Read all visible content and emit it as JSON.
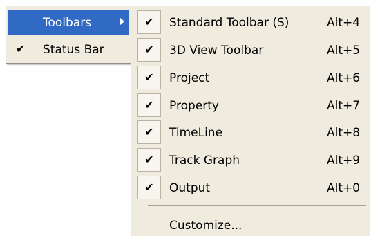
{
  "left_menu": {
    "items": [
      {
        "label": "Toolbars",
        "checked": false,
        "has_submenu": true,
        "highlighted": true
      },
      {
        "label": "Status Bar",
        "checked": true,
        "has_submenu": false,
        "highlighted": false
      }
    ]
  },
  "submenu": {
    "items": [
      {
        "label": "Standard Toolbar (S)",
        "shortcut": "Alt+4",
        "checked": true
      },
      {
        "label": "3D View Toolbar",
        "shortcut": "Alt+5",
        "checked": true
      },
      {
        "label": "Project",
        "shortcut": "Alt+6",
        "checked": true
      },
      {
        "label": "Property",
        "shortcut": "Alt+7",
        "checked": true
      },
      {
        "label": "TimeLine",
        "shortcut": "Alt+8",
        "checked": true
      },
      {
        "label": "Track Graph",
        "shortcut": "Alt+9",
        "checked": true
      },
      {
        "label": "Output",
        "shortcut": "Alt+0",
        "checked": true
      }
    ],
    "customize_label": "Customize..."
  },
  "colors": {
    "menu_bg": "#efebde",
    "highlight_bg": "#316ac5",
    "highlight_text": "#ffffff"
  },
  "icons": {
    "check": "✔",
    "submenu_arrow": "triangle-right"
  }
}
